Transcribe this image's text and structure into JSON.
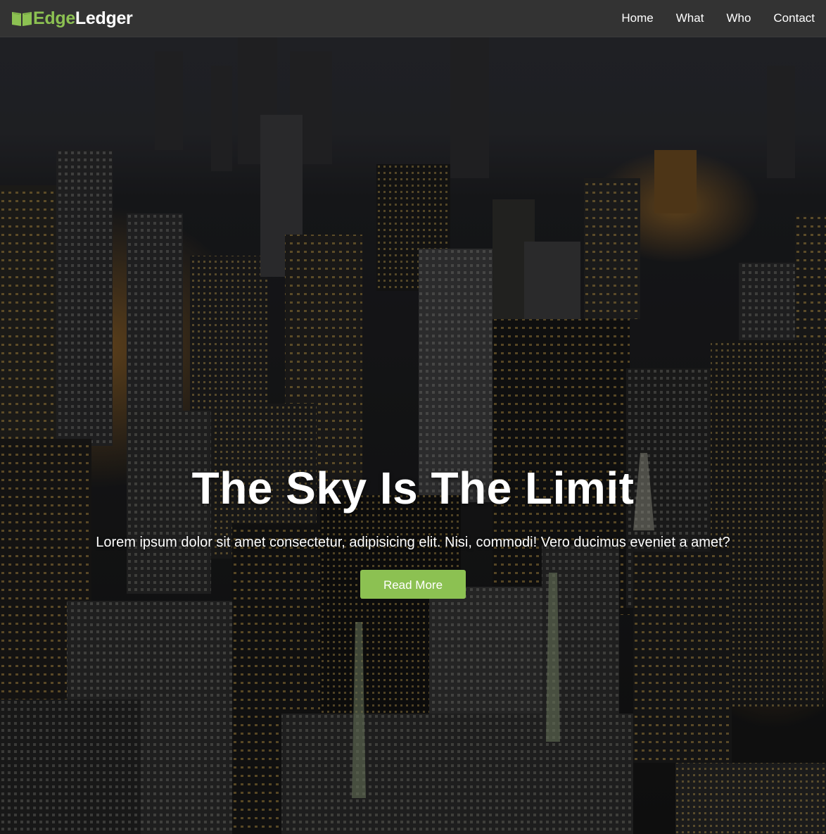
{
  "brand": {
    "name_part1": "Edge",
    "name_part2": "Ledger",
    "icon": "book-icon",
    "accent_color": "#8cc152"
  },
  "nav": {
    "items": [
      {
        "label": "Home"
      },
      {
        "label": "What"
      },
      {
        "label": "Who"
      },
      {
        "label": "Contact"
      }
    ]
  },
  "hero": {
    "background": "city-night-aerial-photo",
    "title": "The Sky Is The Limit",
    "text": "Lorem ipsum dolor sit amet consectetur, adipisicing elit. Nisi, commodi! Vero ducimus eveniet a amet?",
    "button_label": "Read More"
  }
}
